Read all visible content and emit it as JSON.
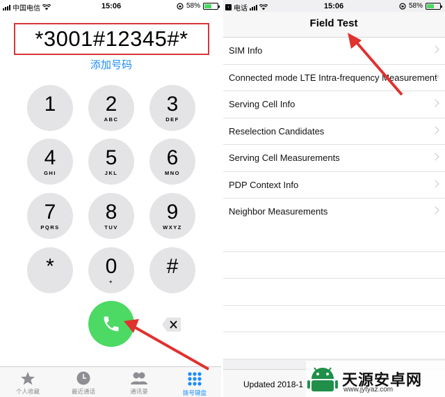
{
  "left": {
    "status": {
      "carrier": "中国电信",
      "time": "15:06",
      "battery": "58%",
      "battery_level": 0.58
    },
    "dialed_number": "*3001#12345#*",
    "add_number": "添加号码",
    "keys": [
      {
        "digit": "1",
        "letters": ""
      },
      {
        "digit": "2",
        "letters": "ABC"
      },
      {
        "digit": "3",
        "letters": "DEF"
      },
      {
        "digit": "4",
        "letters": "GHI"
      },
      {
        "digit": "5",
        "letters": "JKL"
      },
      {
        "digit": "6",
        "letters": "MNO"
      },
      {
        "digit": "7",
        "letters": "PQRS"
      },
      {
        "digit": "8",
        "letters": "TUV"
      },
      {
        "digit": "9",
        "letters": "WXYZ"
      },
      {
        "digit": "*",
        "letters": ""
      },
      {
        "digit": "0",
        "letters": "+"
      },
      {
        "digit": "#",
        "letters": ""
      }
    ],
    "tabs": [
      {
        "label": "个人收藏",
        "icon": "star-icon"
      },
      {
        "label": "最近通话",
        "icon": "clock-icon"
      },
      {
        "label": "通讯录",
        "icon": "contacts-icon"
      },
      {
        "label": "拨号键盘",
        "icon": "keypad-icon",
        "active": true
      }
    ]
  },
  "right": {
    "status": {
      "back_label": "电话",
      "time": "15:06",
      "battery": "58%",
      "battery_level": 0.58
    },
    "title": "Field Test",
    "items": [
      "SIM Info",
      "Connected mode LTE Intra-frequency Measurement",
      "Serving Cell Info",
      "Reselection Candidates",
      "Serving Cell Measurements",
      "PDP Context Info",
      "Neighbor Measurements"
    ],
    "footer": "Updated 2018-1"
  },
  "watermark": {
    "text": "天源安卓网",
    "url": "www.jytyaz.com"
  },
  "colors": {
    "accent": "#1a8cff",
    "call_green": "#4cd964",
    "highlight_red": "#d9343a"
  }
}
